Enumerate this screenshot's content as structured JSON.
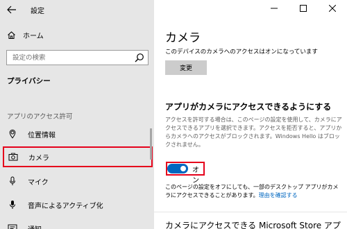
{
  "window": {
    "title": "設定"
  },
  "sidebar": {
    "home_label": "ホーム",
    "search_placeholder": "設定の検索",
    "section_title": "プライバシー",
    "category_label": "アプリのアクセス許可",
    "items": [
      {
        "label": "位置情報",
        "icon": "location-icon"
      },
      {
        "label": "カメラ",
        "icon": "camera-icon",
        "selected": true
      },
      {
        "label": "マイク",
        "icon": "microphone-icon"
      },
      {
        "label": "音声によるアクティブ化",
        "icon": "voice-activation-icon"
      },
      {
        "label": "通知",
        "icon": "notification-icon"
      }
    ]
  },
  "main": {
    "title": "カメラ",
    "device_status": "このデバイスのカメラへのアクセスはオンになっています",
    "change_button": "変更",
    "app_access_heading": "アプリがカメラにアクセスできるようにする",
    "app_access_description": "アクセスを許可する場合は、このページの設定を使用して、カメラにアクセスできるアプリを選択できます。アクセスを拒否すると、アプリからカメラへのアクセスがブロックされます。Windows Hello はブロックされません。",
    "toggle": {
      "state": "on",
      "label": "オン"
    },
    "note_text": "このページの設定をオフにしても、一部のデスクトップ アプリがカメラにアクセスできることがあります。",
    "note_link": "理由を確認する",
    "next_heading": "カメラにアクセスできる Microsoft Store アプ"
  },
  "colors": {
    "accent": "#0067c0",
    "highlight": "#e5001b",
    "sidebar_bg": "#e6e6e6"
  }
}
